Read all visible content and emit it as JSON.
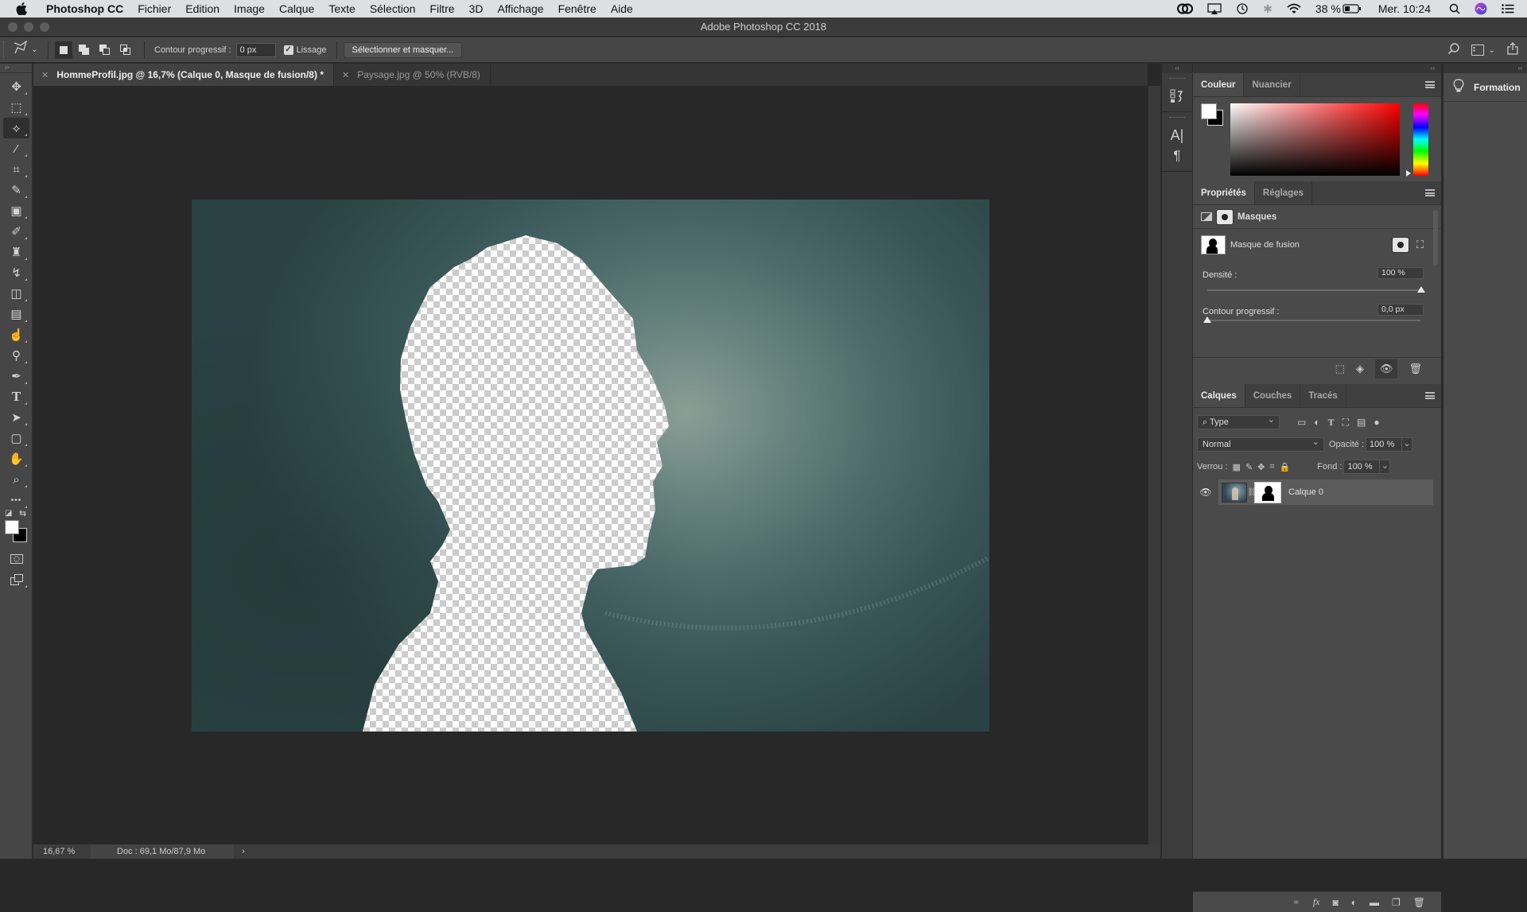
{
  "menubar": {
    "app_name": "Photoshop CC",
    "items": [
      "Fichier",
      "Edition",
      "Image",
      "Calque",
      "Texte",
      "Sélection",
      "Filtre",
      "3D",
      "Affichage",
      "Fenêtre",
      "Aide"
    ],
    "status": {
      "battery_percent": "38 %",
      "clock": "Mer. 10:24"
    }
  },
  "window": {
    "title": "Adobe Photoshop CC 2018"
  },
  "options_bar": {
    "feather_label": "Contour progressif :",
    "feather_value": "0 px",
    "antialias_label": "Lissage",
    "antialias_checked": true,
    "select_mask_button": "Sélectionner et masquer..."
  },
  "tabs": [
    {
      "label": "HommeProfil.jpg @ 16,7% (Calque 0, Masque de fusion/8) *",
      "active": true
    },
    {
      "label": "Paysage.jpg @ 50% (RVB/8)",
      "active": false
    }
  ],
  "tools": [
    {
      "name": "move-tool",
      "glyph": "✥"
    },
    {
      "name": "marquee-tool",
      "glyph": "⬚"
    },
    {
      "name": "polygonal-lasso-tool",
      "glyph": "⟡",
      "active": true
    },
    {
      "name": "magic-wand-tool",
      "glyph": "⁄"
    },
    {
      "name": "crop-tool",
      "glyph": "⌗"
    },
    {
      "name": "eyedropper-tool",
      "glyph": "✎"
    },
    {
      "name": "frame-tool",
      "glyph": "▣"
    },
    {
      "name": "brush-tool",
      "glyph": "✐"
    },
    {
      "name": "clone-stamp-tool",
      "glyph": "♜"
    },
    {
      "name": "history-brush-tool",
      "glyph": "↯"
    },
    {
      "name": "eraser-tool",
      "glyph": "◫"
    },
    {
      "name": "gradient-tool",
      "glyph": "▤"
    },
    {
      "name": "smudge-tool",
      "glyph": "☝"
    },
    {
      "name": "dodge-tool",
      "glyph": "⚲"
    },
    {
      "name": "pen-tool",
      "glyph": "✒"
    },
    {
      "name": "type-tool",
      "glyph": "T"
    },
    {
      "name": "path-selection-tool",
      "glyph": "➤"
    },
    {
      "name": "shape-tool",
      "glyph": "▢"
    },
    {
      "name": "hand-tool",
      "glyph": "✋"
    },
    {
      "name": "zoom-tool",
      "glyph": "⌕"
    },
    {
      "name": "more-tools",
      "glyph": "•••"
    }
  ],
  "status_bar": {
    "zoom": "16,67 %",
    "doc_info": "Doc : 69,1 Mo/87,9 Mo",
    "arrow": "›"
  },
  "color_panel": {
    "tabs": [
      "Couleur",
      "Nuancier"
    ],
    "foreground": "#ffffff",
    "background": "#000000"
  },
  "properties_panel": {
    "tabs": [
      "Propriétés",
      "Réglages"
    ],
    "section": "Masques",
    "mask_label": "Masque de fusion",
    "density_label": "Densité :",
    "density_value": "100 %",
    "density_fraction": 1.0,
    "feather_label": "Contour progressif :",
    "feather_value": "0,0 px",
    "feather_fraction": 0.0
  },
  "layers_panel": {
    "tabs": [
      "Calques",
      "Couches",
      "Tracés"
    ],
    "filter": "Type",
    "blend_mode": "Normal",
    "opacity_label": "Opacité :",
    "opacity_value": "100 %",
    "lock_label": "Verrou :",
    "fill_label": "Fond :",
    "fill_value": "100 %",
    "layers": [
      {
        "name": "Calque 0",
        "visible": true,
        "has_mask": true,
        "selected": true
      }
    ]
  },
  "formation_panel": {
    "label": "Formation"
  }
}
